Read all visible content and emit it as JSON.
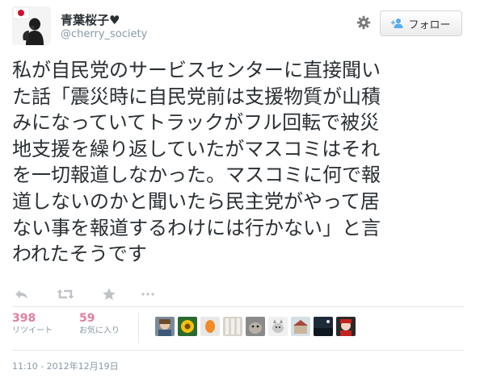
{
  "user": {
    "display_name": "青葉桜子♥",
    "screen_name": "@cherry_society",
    "flag": "japan-flag"
  },
  "follow_button": {
    "label": "フォロー",
    "icon": "add-user-icon"
  },
  "settings_icon": "gear-icon",
  "tweet": {
    "lines": [
      "私が自民党のサービスセンターに直接聞い",
      "た話「震災時に自民党前は支援物質が山積",
      "みになっていてトラックがフル回転で被災",
      "地支援を繰り返していたがマスコミはそれ",
      "を一切報道しなかった。マスコミに何で報",
      "道しないのかと聞いたら民主党がやって居",
      "ない事を報道するわけには行かない」と言",
      "われたそうです"
    ]
  },
  "actions": [
    "reply-icon",
    "retweet-icon",
    "favorite-icon",
    "more-icon"
  ],
  "stats": {
    "retweets": {
      "count": "398",
      "label": "リツイート"
    },
    "favorites": {
      "count": "59",
      "label": "お気に入り"
    }
  },
  "favoriters": [
    "avatar-1",
    "avatar-2",
    "avatar-3",
    "avatar-4",
    "avatar-5",
    "avatar-6",
    "avatar-7",
    "avatar-8",
    "avatar-9"
  ],
  "timestamp": "11:10 - 2012年12月19日",
  "colors": {
    "accent": "#55acee",
    "count": "#e07ea0",
    "muted": "#8899a6"
  }
}
